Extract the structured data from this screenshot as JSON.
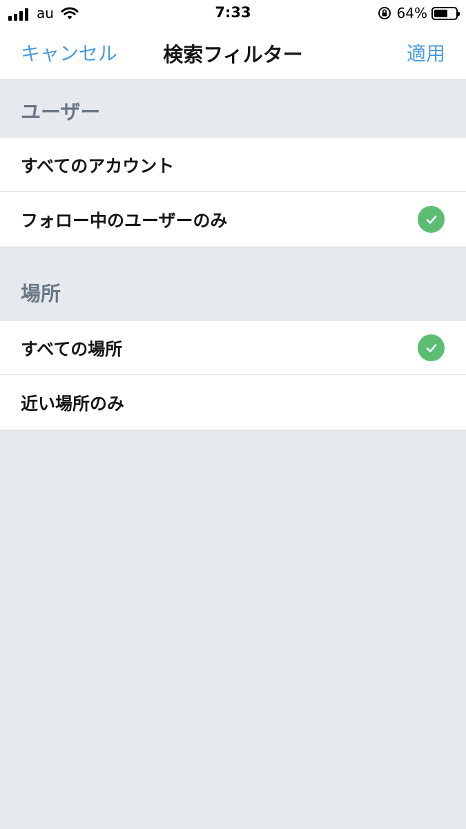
{
  "status_bar": {
    "carrier": "au",
    "time": "7:33",
    "battery_percent": "64%",
    "battery_level": 0.64
  },
  "nav": {
    "cancel_label": "キャンセル",
    "title": "検索フィルター",
    "apply_label": "適用"
  },
  "sections": {
    "users": {
      "header": "ユーザー",
      "items": [
        {
          "label": "すべてのアカウント",
          "selected": false
        },
        {
          "label": "フォロー中のユーザーのみ",
          "selected": true
        }
      ]
    },
    "location": {
      "header": "場所",
      "items": [
        {
          "label": "すべての場所",
          "selected": true
        },
        {
          "label": "近い場所のみ",
          "selected": false
        }
      ]
    }
  },
  "colors": {
    "accent": "#4a9be0",
    "check": "#5bbd72",
    "background": "#e6e9ee"
  },
  "icons": {
    "signal": "cellular-signal-icon",
    "wifi": "wifi-icon",
    "rotation_lock": "rotation-lock-icon",
    "battery": "battery-icon",
    "checkmark": "checkmark-icon"
  }
}
